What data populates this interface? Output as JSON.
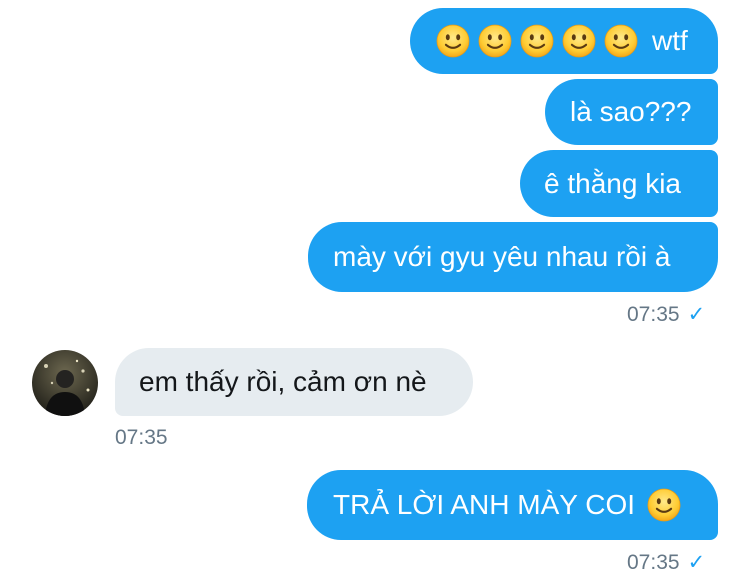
{
  "conversation": {
    "messages": [
      {
        "id": "m1",
        "direction": "outgoing",
        "emoji": [
          "slightly-smiling-face",
          "slightly-smiling-face",
          "slightly-smiling-face",
          "slightly-smiling-face",
          "slightly-smiling-face"
        ],
        "text": "wtf"
      },
      {
        "id": "m2",
        "direction": "outgoing",
        "text": "là sao???"
      },
      {
        "id": "m3",
        "direction": "outgoing",
        "text": "ê thằng kia"
      },
      {
        "id": "m4",
        "direction": "outgoing",
        "text": "mày với gyu yêu nhau rồi à"
      },
      {
        "id": "m5",
        "direction": "incoming",
        "text": "em thấy rồi, cảm ơn nè"
      },
      {
        "id": "m6",
        "direction": "outgoing",
        "text": "TRẢ LỜI ANH MÀY COI",
        "trailing_emoji": "slightly-smiling-face"
      }
    ],
    "timestamps": {
      "outgoing_group_1": "07:35",
      "incoming_group": "07:35",
      "outgoing_group_2": "07:35"
    },
    "read_receipt_icon": "check-icon"
  },
  "colors": {
    "outgoing_bubble": "#1da1f2",
    "incoming_bubble": "#e6ecf0",
    "timestamp": "#657786"
  }
}
